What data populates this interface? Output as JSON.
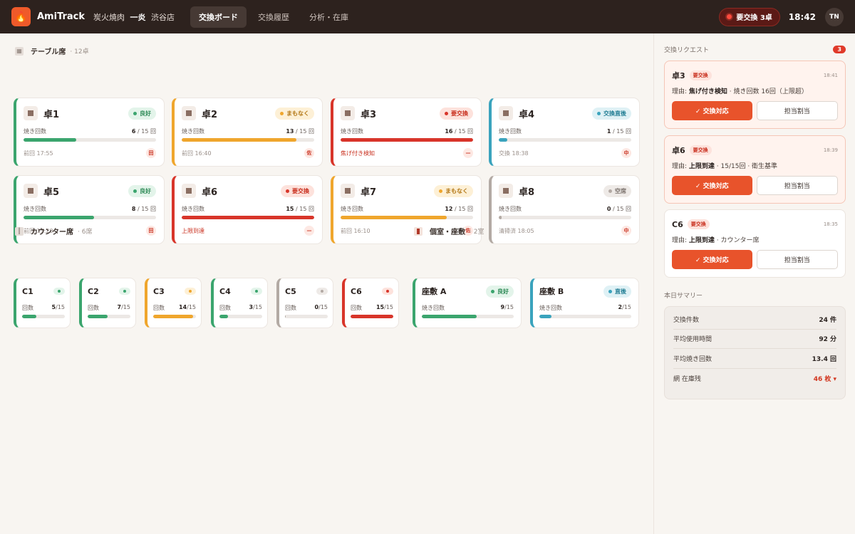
{
  "header": {
    "brand": "AmiTrack",
    "store_prefix": "炭火焼肉",
    "store_name": "一炎",
    "store_branch": "渋谷店",
    "tabs": [
      "交換ボード",
      "交換履歴",
      "分析・在庫"
    ],
    "alert": "要交換 3卓",
    "clock": "18:42",
    "user": "TN"
  },
  "colors": {
    "good": "#3ba56e",
    "soon": "#efa62d",
    "need": "#d8352a",
    "fresh": "#3aa3bd",
    "empty": "#b3aaa4"
  },
  "tables": {
    "title": "テーブル席",
    "count": "· 12卓",
    "items": [
      {
        "name": "卓1",
        "badge": "良好",
        "label": "焼き回数",
        "uses": "6",
        "max": "/ 15 回",
        "progress": 0.4,
        "foot": "前回 17:55",
        "staff": "田",
        "status": "good"
      },
      {
        "name": "卓2",
        "badge": "まもなく",
        "label": "焼き回数",
        "uses": "13",
        "max": "/ 15 回",
        "progress": 0.867,
        "foot": "前回 16:40",
        "staff": "佐",
        "status": "soon"
      },
      {
        "name": "卓3",
        "badge": "要交換",
        "label": "焼き回数",
        "uses": "16",
        "max": "/ 15 回",
        "progress": 1,
        "foot": "焦げ付き検知",
        "staff": "—",
        "status": "need"
      },
      {
        "name": "卓4",
        "badge": "交換直後",
        "label": "焼き回数",
        "uses": "1",
        "max": "/ 15 回",
        "progress": 0.067,
        "foot": "交換 18:38",
        "staff": "中",
        "status": "fresh"
      },
      {
        "name": "卓5",
        "badge": "良好",
        "label": "焼き回数",
        "uses": "8",
        "max": "/ 15 回",
        "progress": 0.533,
        "foot": "前回 17:20",
        "staff": "田",
        "status": "good"
      },
      {
        "name": "卓6",
        "badge": "要交換",
        "label": "焼き回数",
        "uses": "15",
        "max": "/ 15 回",
        "progress": 1,
        "foot": "上限到達",
        "staff": "—",
        "status": "need"
      },
      {
        "name": "卓7",
        "badge": "まもなく",
        "label": "焼き回数",
        "uses": "12",
        "max": "/ 15 回",
        "progress": 0.8,
        "foot": "前回 16:10",
        "staff": "佐",
        "status": "soon"
      },
      {
        "name": "卓8",
        "badge": "空席",
        "label": "焼き回数",
        "uses": "0",
        "max": "/ 15 回",
        "progress": 0.02,
        "foot": "清掃済 18:05",
        "staff": "中",
        "status": "empty"
      }
    ]
  },
  "counter": {
    "title": "カウンター席",
    "count": "· 6席",
    "items": [
      {
        "name": "C1",
        "label": "回数",
        "uses": "5",
        "max": "/15",
        "progress": 0.333,
        "status": "good"
      },
      {
        "name": "C2",
        "label": "回数",
        "uses": "7",
        "max": "/15",
        "progress": 0.467,
        "status": "good"
      },
      {
        "name": "C3",
        "label": "回数",
        "uses": "14",
        "max": "/15",
        "progress": 0.933,
        "status": "soon"
      },
      {
        "name": "C4",
        "label": "回数",
        "uses": "3",
        "max": "/15",
        "progress": 0.2,
        "status": "good"
      },
      {
        "name": "C5",
        "label": "回数",
        "uses": "0",
        "max": "/15",
        "progress": 0.02,
        "status": "empty"
      },
      {
        "name": "C6",
        "label": "回数",
        "uses": "15",
        "max": "/15",
        "progress": 1,
        "status": "need"
      }
    ]
  },
  "rooms": {
    "title": "個室・座敷",
    "count": "· 2室",
    "items": [
      {
        "name": "座敷 A",
        "badge": "良好",
        "label": "焼き回数",
        "uses": "9",
        "max": "/15",
        "progress": 0.6,
        "status": "good"
      },
      {
        "name": "座敷 B",
        "badge": "直後",
        "label": "焼き回数",
        "uses": "2",
        "max": "/15",
        "progress": 0.133,
        "status": "fresh"
      }
    ]
  },
  "requests": {
    "title": "交換リクエスト",
    "count": "3",
    "items": [
      {
        "name": "卓3",
        "tag": "要交換",
        "time": "18:41",
        "reason_label": "理由:",
        "reason_bold": "焦げ付き検知",
        "reason_rest": " · 焼き回数 16回（上限超）",
        "primary": "✓ 交換対応",
        "secondary": "担当割当"
      },
      {
        "name": "卓6",
        "tag": "要交換",
        "time": "18:39",
        "reason_label": "理由:",
        "reason_bold": "上限到達",
        "reason_rest": " · 15/15回 · 衛生基準",
        "primary": "✓ 交換対応",
        "secondary": "担当割当"
      },
      {
        "name": "C6",
        "tag": "要交換",
        "time": "18:35",
        "reason_label": "理由:",
        "reason_bold": "上限到達",
        "reason_rest": " · カウンター席",
        "primary": "✓ 交換対応",
        "secondary": "担当割当"
      }
    ]
  },
  "summary": {
    "title": "本日サマリー",
    "rows": [
      {
        "label": "交換件数",
        "value": "24 件"
      },
      {
        "label": "平均使用時間",
        "value": "92 分"
      },
      {
        "label": "平均焼き回数",
        "value": "13.4 回"
      },
      {
        "label": "網 在庫残",
        "value": "46 枚 ▾"
      }
    ]
  }
}
